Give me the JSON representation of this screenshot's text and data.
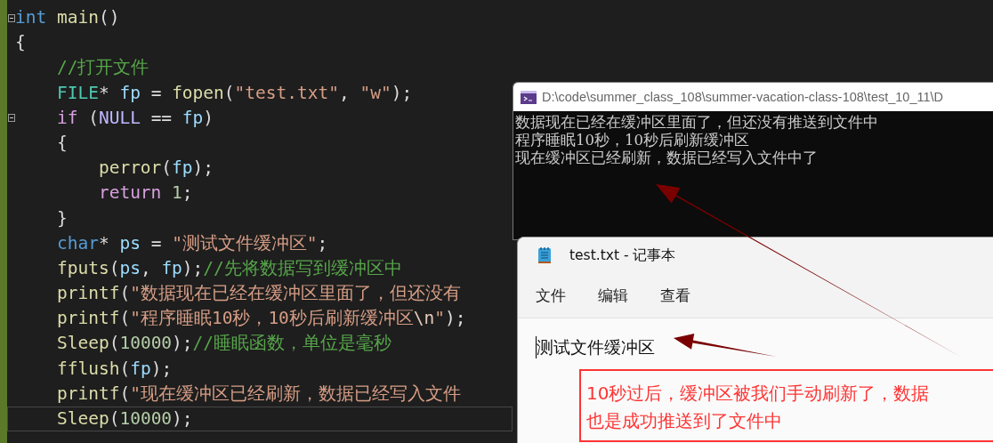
{
  "editor": {
    "lines": [
      {
        "fold": true,
        "current": false,
        "tokens": [
          {
            "kind": "keyword",
            "text": "int"
          },
          {
            "kind": "func",
            "text": "main"
          },
          {
            "kind": "plain",
            "text": "()"
          }
        ]
      },
      {
        "fold": false,
        "current": false,
        "tokens": [
          {
            "kind": "plain",
            "text": "{"
          }
        ],
        "children": [
          {
            "fold": false,
            "current": false,
            "tokens": [
              {
                "kind": "comment",
                "text": "//打开文件"
              }
            ]
          },
          {
            "fold": false,
            "current": false,
            "tokens": [
              {
                "kind": "type",
                "text": "FILE"
              },
              {
                "kind": "plain",
                "text": "* "
              },
              {
                "kind": "var",
                "text": "fp"
              },
              {
                "kind": "plain",
                "text": " = "
              },
              {
                "kind": "func",
                "text": "fopen"
              },
              {
                "kind": "plain",
                "text": "("
              },
              {
                "kind": "string",
                "text": "\"test.txt\""
              },
              {
                "kind": "plain",
                "text": ", "
              },
              {
                "kind": "string",
                "text": "\"w\""
              },
              {
                "kind": "plain",
                "text": ");"
              }
            ]
          },
          {
            "fold": true,
            "current": false,
            "tokens": [
              {
                "kind": "control",
                "text": "if"
              },
              {
                "kind": "plain",
                "text": " ("
              },
              {
                "kind": "macro",
                "text": "NULL"
              },
              {
                "kind": "plain",
                "text": " == "
              },
              {
                "kind": "var",
                "text": "fp"
              },
              {
                "kind": "plain",
                "text": ")"
              }
            ]
          },
          {
            "fold": false,
            "current": false,
            "tokens": [
              {
                "kind": "plain",
                "text": "{"
              }
            ],
            "children": [
              {
                "fold": false,
                "current": false,
                "tokens": [
                  {
                    "kind": "func",
                    "text": "perror"
                  },
                  {
                    "kind": "plain",
                    "text": "("
                  },
                  {
                    "kind": "var",
                    "text": "fp"
                  },
                  {
                    "kind": "plain",
                    "text": ");"
                  }
                ]
              },
              {
                "fold": false,
                "current": false,
                "tokens": [
                  {
                    "kind": "control",
                    "text": "return"
                  },
                  {
                    "kind": "number",
                    "text": "1"
                  },
                  {
                    "kind": "plain",
                    "text": ";"
                  }
                ]
              }
            ]
          },
          {
            "fold": false,
            "current": false,
            "tokens": [
              {
                "kind": "plain",
                "text": "}"
              }
            ]
          },
          {
            "fold": false,
            "current": false,
            "tokens": [
              {
                "kind": "keyword",
                "text": "char"
              },
              {
                "kind": "plain",
                "text": "* "
              },
              {
                "kind": "var",
                "text": "ps"
              },
              {
                "kind": "plain",
                "text": " = "
              },
              {
                "kind": "string",
                "text": "\"测试文件缓冲区\""
              },
              {
                "kind": "plain",
                "text": ";"
              }
            ]
          },
          {
            "fold": false,
            "current": false,
            "tokens": [
              {
                "kind": "func",
                "text": "fputs"
              },
              {
                "kind": "plain",
                "text": "("
              },
              {
                "kind": "var",
                "text": "ps"
              },
              {
                "kind": "plain",
                "text": ", "
              },
              {
                "kind": "var",
                "text": "fp"
              },
              {
                "kind": "plain",
                "text": ");"
              },
              {
                "kind": "comment",
                "text": "//先将数据写到缓冲区中"
              }
            ]
          },
          {
            "fold": false,
            "current": false,
            "tokens": [
              {
                "kind": "func",
                "text": "printf"
              },
              {
                "kind": "plain",
                "text": "("
              },
              {
                "kind": "string",
                "text": "\"数据现在已经在缓冲区里面了，但还没有"
              }
            ]
          },
          {
            "fold": false,
            "current": false,
            "tokens": [
              {
                "kind": "func",
                "text": "printf"
              },
              {
                "kind": "plain",
                "text": "("
              },
              {
                "kind": "string",
                "text": "\"程序睡眠10秒，10秒后刷新缓冲区"
              },
              {
                "kind": "escape",
                "text": "\\n"
              },
              {
                "kind": "string",
                "text": "\""
              },
              {
                "kind": "plain",
                "text": ");"
              }
            ]
          },
          {
            "fold": false,
            "current": false,
            "tokens": [
              {
                "kind": "func",
                "text": "Sleep"
              },
              {
                "kind": "plain",
                "text": "("
              },
              {
                "kind": "number",
                "text": "10000"
              },
              {
                "kind": "plain",
                "text": ");"
              },
              {
                "kind": "comment",
                "text": "//睡眠函数，单位是毫秒"
              }
            ]
          },
          {
            "fold": false,
            "current": false,
            "tokens": [
              {
                "kind": "func",
                "text": "fflush"
              },
              {
                "kind": "plain",
                "text": "("
              },
              {
                "kind": "var",
                "text": "fp"
              },
              {
                "kind": "plain",
                "text": ");"
              }
            ]
          },
          {
            "fold": false,
            "current": false,
            "tokens": [
              {
                "kind": "func",
                "text": "printf"
              },
              {
                "kind": "plain",
                "text": "("
              },
              {
                "kind": "string",
                "text": "\"现在缓冲区已经刷新，数据已经写入文件"
              }
            ]
          },
          {
            "fold": false,
            "current": true,
            "tokens": [
              {
                "kind": "func",
                "text": "Sleep"
              },
              {
                "kind": "plain",
                "text": "("
              },
              {
                "kind": "number",
                "text": "10000"
              },
              {
                "kind": "plain",
                "text": ");"
              }
            ]
          }
        ]
      }
    ]
  },
  "console": {
    "title": "D:\\code\\summer_class_108\\summer-vacation-class-108\\test_10_11\\D",
    "output": [
      "数据现在已经在缓冲区里面了，但还没有推送到文件中",
      "程序睡眠10秒，10秒后刷新缓冲区",
      "现在缓冲区已经刷新，数据已经写入文件中了"
    ]
  },
  "notepad": {
    "title": "test.txt - 记事本",
    "menu": [
      "文件",
      "编辑",
      "查看"
    ],
    "content": "测试文件缓冲区"
  },
  "annotation": {
    "lines": [
      "10秒过后，缓冲区被我们手动刷新了，数据",
      "也是成功推送到了文件中"
    ]
  }
}
